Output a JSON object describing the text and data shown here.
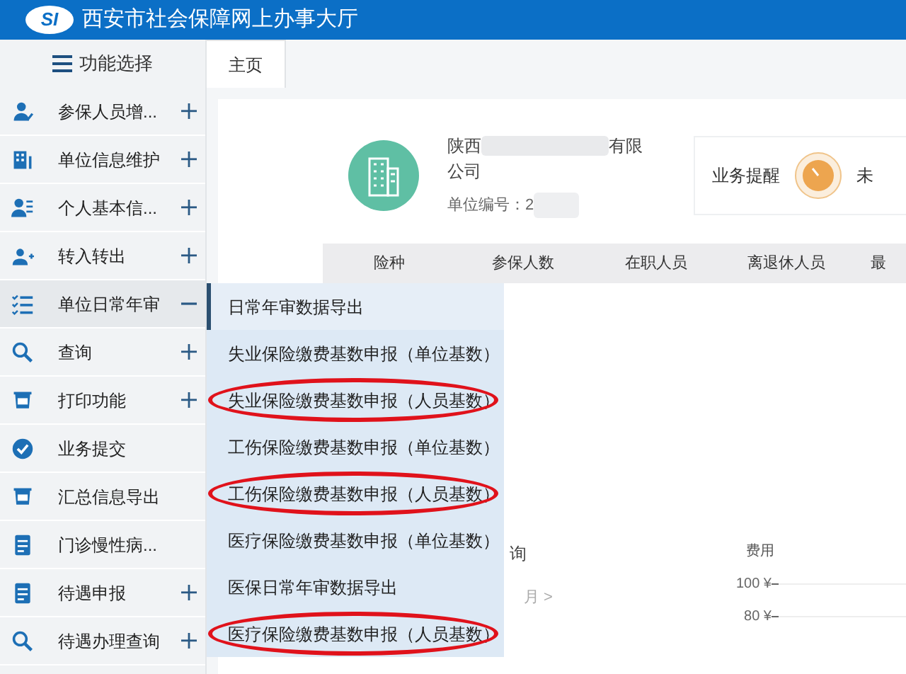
{
  "header": {
    "title": "西安市社会保障网上办事大厅",
    "logo": "SI"
  },
  "sidebar": {
    "title": "功能选择",
    "items": [
      {
        "label": "参保人员增...",
        "kind": "group",
        "expanded": false
      },
      {
        "label": "单位信息维护",
        "kind": "group",
        "expanded": false
      },
      {
        "label": "个人基本信...",
        "kind": "group",
        "expanded": false
      },
      {
        "label": "转入转出",
        "kind": "group",
        "expanded": false
      },
      {
        "label": "单位日常年审",
        "kind": "group",
        "expanded": true
      },
      {
        "label": "查询",
        "kind": "group",
        "expanded": false
      },
      {
        "label": "打印功能",
        "kind": "group",
        "expanded": false
      },
      {
        "label": "业务提交",
        "kind": "link"
      },
      {
        "label": "汇总信息导出",
        "kind": "link"
      },
      {
        "label": "门诊慢性病...",
        "kind": "link"
      },
      {
        "label": "待遇申报",
        "kind": "group",
        "expanded": false
      },
      {
        "label": "待遇办理查询",
        "kind": "group",
        "expanded": false
      }
    ]
  },
  "submenu": [
    {
      "label": "日常年审数据导出",
      "selected": true,
      "circled": false
    },
    {
      "label": "失业保险缴费基数申报（单位基数）",
      "selected": false,
      "circled": false
    },
    {
      "label": "失业保险缴费基数申报（人员基数）",
      "selected": false,
      "circled": true
    },
    {
      "label": "工伤保险缴费基数申报（单位基数）",
      "selected": false,
      "circled": false
    },
    {
      "label": "工伤保险缴费基数申报（人员基数）",
      "selected": false,
      "circled": true
    },
    {
      "label": "医疗保险缴费基数申报（单位基数）",
      "selected": false,
      "circled": false
    },
    {
      "label": "医保日常年审数据导出",
      "selected": false,
      "circled": false
    },
    {
      "label": "医疗保险缴费基数申报（人员基数）",
      "selected": false,
      "circled": true
    }
  ],
  "tabs": [
    {
      "label": "主页",
      "selected": true
    }
  ],
  "company": {
    "name_start": "陕西",
    "name_end": "有限",
    "name_line2": "公司",
    "unit_number": "单位编号：2"
  },
  "reminder": {
    "label": "业务提醒",
    "status": "未"
  },
  "table": {
    "columns": [
      "险种",
      "参保人数",
      "在职人员",
      "离退休人员",
      "最"
    ]
  },
  "query_panel": {
    "title": "询",
    "month_nav": "月 >"
  },
  "cost_chart": {
    "title": "费用",
    "ticks": [
      "100 ¥",
      "80 ¥"
    ]
  }
}
